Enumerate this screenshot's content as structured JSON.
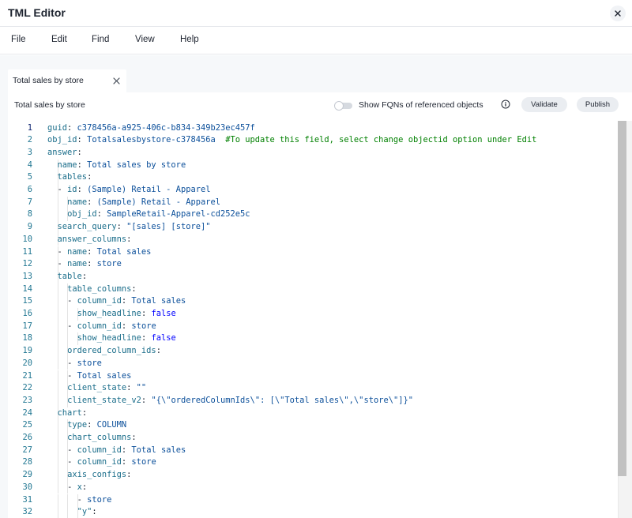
{
  "window": {
    "title": "TML Editor"
  },
  "menu": [
    "File",
    "Edit",
    "Find",
    "View",
    "Help"
  ],
  "tab": {
    "label": "Total sales by store"
  },
  "toolbar": {
    "doc_title": "Total sales by store",
    "toggle_label": "Show FQNs of referenced objects",
    "toggle_on": false,
    "validate_label": "Validate",
    "publish_label": "Publish"
  },
  "editor": {
    "active_line": 1,
    "lines": [
      {
        "n": "1",
        "indent": 0,
        "key": "guid",
        "val": "c378456a-a925-406c-b834-349b23ec457f"
      },
      {
        "n": "2",
        "indent": 0,
        "key": "obj_id",
        "val": "Totalsalesbystore-c378456a",
        "comment": "#To update this field, select change objectid option under Edit"
      },
      {
        "n": "3",
        "indent": 0,
        "key": "answer"
      },
      {
        "n": "4",
        "indent": 1,
        "key": "name",
        "val": "Total sales by store"
      },
      {
        "n": "5",
        "indent": 1,
        "key": "tables"
      },
      {
        "n": "6",
        "indent": 1,
        "dash": true,
        "key": "id",
        "val": "(Sample) Retail - Apparel"
      },
      {
        "n": "7",
        "indent": 2,
        "key": "name",
        "val": "(Sample) Retail - Apparel"
      },
      {
        "n": "8",
        "indent": 2,
        "key": "obj_id",
        "val": "SampleRetail-Apparel-cd252e5c"
      },
      {
        "n": "9",
        "indent": 1,
        "key": "search_query",
        "val": "\"[sales] [store]\""
      },
      {
        "n": "10",
        "indent": 1,
        "key": "answer_columns"
      },
      {
        "n": "11",
        "indent": 1,
        "dash": true,
        "key": "name",
        "val": "Total sales"
      },
      {
        "n": "12",
        "indent": 1,
        "dash": true,
        "key": "name",
        "val": "store"
      },
      {
        "n": "13",
        "indent": 1,
        "key": "table"
      },
      {
        "n": "14",
        "indent": 2,
        "key": "table_columns"
      },
      {
        "n": "15",
        "indent": 2,
        "dash": true,
        "key": "column_id",
        "val": "Total sales"
      },
      {
        "n": "16",
        "indent": 3,
        "key": "show_headline",
        "val": "false",
        "bool": true
      },
      {
        "n": "17",
        "indent": 2,
        "dash": true,
        "key": "column_id",
        "val": "store"
      },
      {
        "n": "18",
        "indent": 3,
        "key": "show_headline",
        "val": "false",
        "bool": true
      },
      {
        "n": "19",
        "indent": 2,
        "key": "ordered_column_ids"
      },
      {
        "n": "20",
        "indent": 2,
        "dash": true,
        "val": "store"
      },
      {
        "n": "21",
        "indent": 2,
        "dash": true,
        "val": "Total sales"
      },
      {
        "n": "22",
        "indent": 2,
        "key": "client_state",
        "val": "\"\""
      },
      {
        "n": "23",
        "indent": 2,
        "key": "client_state_v2",
        "val": "\"{\\\"orderedColumnIds\\\": [\\\"Total sales\\\",\\\"store\\\"]}\""
      },
      {
        "n": "24",
        "indent": 1,
        "key": "chart"
      },
      {
        "n": "25",
        "indent": 2,
        "key": "type",
        "val": "COLUMN"
      },
      {
        "n": "26",
        "indent": 2,
        "key": "chart_columns"
      },
      {
        "n": "27",
        "indent": 2,
        "dash": true,
        "key": "column_id",
        "val": "Total sales"
      },
      {
        "n": "28",
        "indent": 2,
        "dash": true,
        "key": "column_id",
        "val": "store"
      },
      {
        "n": "29",
        "indent": 2,
        "key": "axis_configs"
      },
      {
        "n": "30",
        "indent": 2,
        "dash": true,
        "key": "x"
      },
      {
        "n": "31",
        "indent": 3,
        "dash": true,
        "val": "store"
      },
      {
        "n": "32",
        "indent": 3,
        "key": "\"y\""
      }
    ]
  },
  "colors": {
    "key": "#1a6d8a",
    "value": "#0b4f9a",
    "boolean": "#0000ff",
    "comment": "#008000",
    "line_number": "#237893"
  }
}
